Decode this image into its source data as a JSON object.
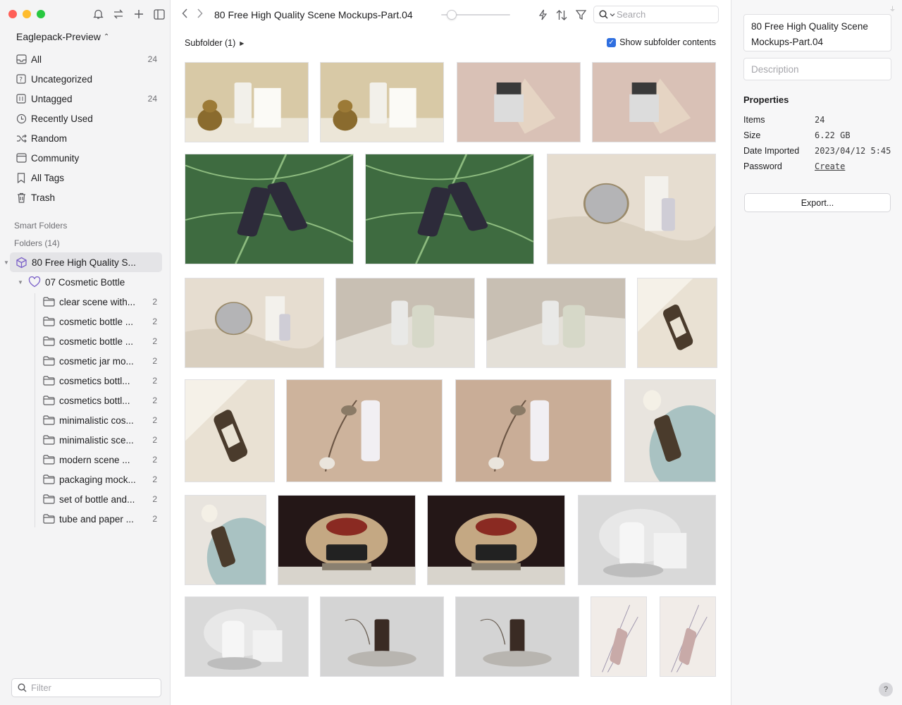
{
  "sidebar": {
    "library_name": "Eaglepack-Preview",
    "nav": [
      {
        "label": "All",
        "count": "24",
        "icon": "inbox-icon"
      },
      {
        "label": "Uncategorized",
        "count": "",
        "icon": "question-folder-icon"
      },
      {
        "label": "Untagged",
        "count": "24",
        "icon": "untagged-icon"
      },
      {
        "label": "Recently Used",
        "count": "",
        "icon": "clock-icon"
      },
      {
        "label": "Random",
        "count": "",
        "icon": "shuffle-icon"
      },
      {
        "label": "Community",
        "count": "",
        "icon": "community-icon"
      },
      {
        "label": "All Tags",
        "count": "",
        "icon": "bookmark-icon"
      },
      {
        "label": "Trash",
        "count": "",
        "icon": "trash-icon"
      }
    ],
    "smart_folders_label": "Smart Folders",
    "folders_label": "Folders (14)",
    "root_folder": "80 Free High Quality S...",
    "subfolder": "07 Cosmetic Bottle",
    "folders": [
      {
        "label": "clear scene with...",
        "count": "2"
      },
      {
        "label": "cosmetic bottle ...",
        "count": "2"
      },
      {
        "label": "cosmetic bottle ...",
        "count": "2"
      },
      {
        "label": "cosmetic jar mo...",
        "count": "2"
      },
      {
        "label": "cosmetics bottl...",
        "count": "2"
      },
      {
        "label": "cosmetics bottl...",
        "count": "2"
      },
      {
        "label": "minimalistic cos...",
        "count": "2"
      },
      {
        "label": "minimalistic sce...",
        "count": "2"
      },
      {
        "label": "modern scene ...",
        "count": "2"
      },
      {
        "label": "packaging mock...",
        "count": "2"
      },
      {
        "label": "set of bottle and...",
        "count": "2"
      },
      {
        "label": "tube and paper ...",
        "count": "2"
      }
    ],
    "filter_placeholder": "Filter"
  },
  "main": {
    "title": "80 Free High Quality Scene Mockups-Part.04",
    "search_placeholder": "Search",
    "subfolder_label": "Subfolder (1)",
    "show_subfolder_label": "Show subfolder contents"
  },
  "inspector": {
    "title": "80 Free High Quality Scene Mockups-Part.04",
    "description_placeholder": "Description",
    "properties_heading": "Properties",
    "properties": [
      {
        "key": "Items",
        "value": "24"
      },
      {
        "key": "Size",
        "value": "6.22 GB"
      },
      {
        "key": "Date Imported",
        "value": "2023/04/12 5:45"
      },
      {
        "key": "Password",
        "value": "Create"
      }
    ],
    "export_label": "Export...",
    "help_label": "?"
  },
  "colors": {
    "accent": "#2f6fe0",
    "folder_purple": "#7b61c9",
    "traffic_red": "#ff5f57",
    "traffic_yellow": "#febc2e",
    "traffic_green": "#28c840"
  },
  "thumbnails": [
    {
      "scene": "box-vase-gold",
      "bg": "#d8c9a6"
    },
    {
      "scene": "box-vase-gold",
      "bg": "#d8c9a6"
    },
    {
      "scene": "jar-card-pink",
      "bg": "#d9c1b6"
    },
    {
      "scene": "jar-card-pink",
      "bg": "#d9c1b6"
    },
    {
      "scene": "leaf-dropper",
      "bg": "#4a7a4c"
    },
    {
      "scene": "leaf-dropper",
      "bg": "#4a7a4c"
    },
    {
      "scene": "mirror-cloth",
      "bg": "#e6ddd0"
    },
    {
      "scene": "mirror-cloth",
      "bg": "#e6ddd0"
    },
    {
      "scene": "tubes-shadow",
      "bg": "#c8bfb3"
    },
    {
      "scene": "tubes-shadow",
      "bg": "#c8bfb3"
    },
    {
      "scene": "pump-bottle-cream",
      "bg": "#e9e1d3"
    },
    {
      "scene": "pump-bottle-cream",
      "bg": "#e9e1d3"
    },
    {
      "scene": "dropper-flowers-tan",
      "bg": "#cdb39c"
    },
    {
      "scene": "dropper-flowers-tan",
      "bg": "#c9ad97"
    },
    {
      "scene": "bottle-plate-blue",
      "bg": "#e8e4de"
    },
    {
      "scene": "bottle-plate-blue",
      "bg": "#e8e4de"
    },
    {
      "scene": "jar-pomegranate-dark",
      "bg": "#2a1a1a"
    },
    {
      "scene": "jar-pomegranate-dark",
      "bg": "#2a1a1a"
    },
    {
      "scene": "white-bottle-stone",
      "bg": "#d9d9d9"
    },
    {
      "scene": "white-bottle-stone",
      "bg": "#d9d9d9"
    },
    {
      "scene": "dropper-stone-grey",
      "bg": "#d4d4d4"
    },
    {
      "scene": "dropper-stone-grey",
      "bg": "#d4d4d4"
    },
    {
      "scene": "lavender-tube",
      "bg": "#f1ece8"
    },
    {
      "scene": "lavender-tube",
      "bg": "#f1ece8"
    }
  ]
}
